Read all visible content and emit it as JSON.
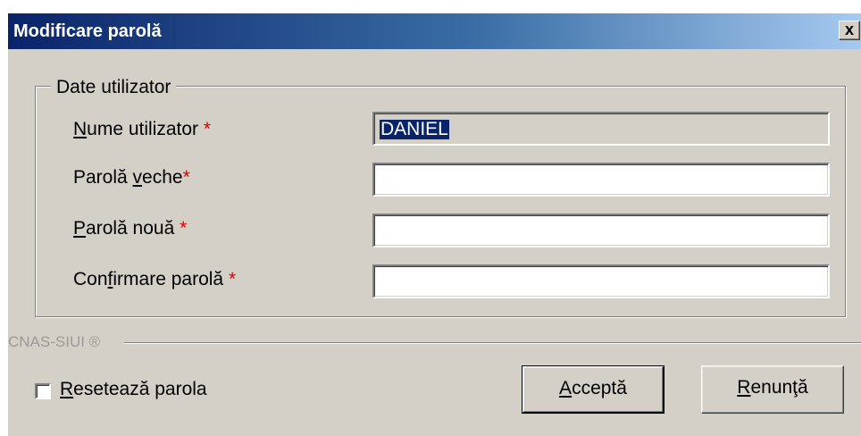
{
  "window": {
    "title": "Modificare parolă",
    "close_label": "x"
  },
  "group": {
    "title": "Date utilizator"
  },
  "fields": [
    {
      "label_mnemonic": "N",
      "label_rest": "ume utilizator ",
      "required_mark": "*",
      "value": "DANIEL",
      "readonly": true,
      "selected": true
    },
    {
      "label_pre": "Parolă ",
      "label_mnemonic": "v",
      "label_rest": "eche",
      "required_mark": "*",
      "value": ""
    },
    {
      "label_mnemonic": "P",
      "label_rest": "arolă nouă ",
      "required_mark": "*",
      "value": ""
    },
    {
      "label_pre": "Con",
      "label_mnemonic": "f",
      "label_rest": "irmare parolă ",
      "required_mark": "*",
      "value": ""
    }
  ],
  "footer": {
    "brand": "CNAS-SIUI ®"
  },
  "reset_checkbox": {
    "mnemonic": "R",
    "label_rest": "esetează parola",
    "checked": false
  },
  "buttons": {
    "accept_mnemonic": "A",
    "accept_rest": "cceptă",
    "cancel_mnemonic": "R",
    "cancel_rest": "enunţă"
  },
  "colors": {
    "title_gradient_start": "#0a246a",
    "title_gradient_end": "#a6caf0",
    "dialog_bg": "#d4d0c8",
    "required": "#e00000",
    "selection": "#0a246a"
  }
}
